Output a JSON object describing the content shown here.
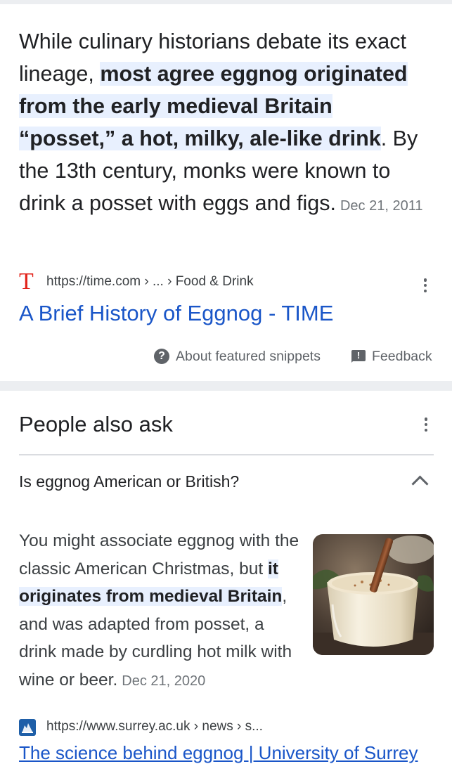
{
  "featured_snippet": {
    "text_before": "While culinary historians debate its exact lineage, ",
    "text_highlight": "most agree eggnog originated from the early medieval Britain “posset,” a hot, milky, ale-like drink",
    "text_after": ". By the 13th century, monks were known to drink a posset with eggs and figs.",
    "date": "Dec 21, 2011",
    "source_favicon_letter": "T",
    "source_url": "https://time.com › ... › Food & Drink",
    "link_title": "A Brief History of Eggnog - TIME",
    "about_label": "About featured snippets",
    "feedback_label": "Feedback",
    "feedback_icon_glyph": "!",
    "about_icon_glyph": "?"
  },
  "people_also_ask": {
    "title": "People also ask",
    "question": "Is eggnog American or British?",
    "answer_before": "You might associate eggnog with the classic American Christmas, but ",
    "answer_highlight": "it originates from medieval Britain",
    "answer_after": ", and was adapted from posset, a drink made by curdling hot milk with wine or beer.",
    "answer_date": "Dec 21, 2020",
    "answer_source_url": "https://www.surrey.ac.uk › news › s...",
    "answer_link_title": "The science behind eggnog | University of Surrey"
  },
  "icons": {
    "favicon_time": "time-favicon",
    "more": "more-vert-icon",
    "help": "help-circle-icon",
    "feedback": "feedback-icon",
    "expand": "chevron-up-icon",
    "favicon_surrey": "surrey-favicon"
  },
  "colors": {
    "link": "#1a56c8",
    "highlight": "#e8f0fe",
    "time_brand": "#e2231a",
    "muted": "#5f6368",
    "section_bg": "#eceef1"
  }
}
